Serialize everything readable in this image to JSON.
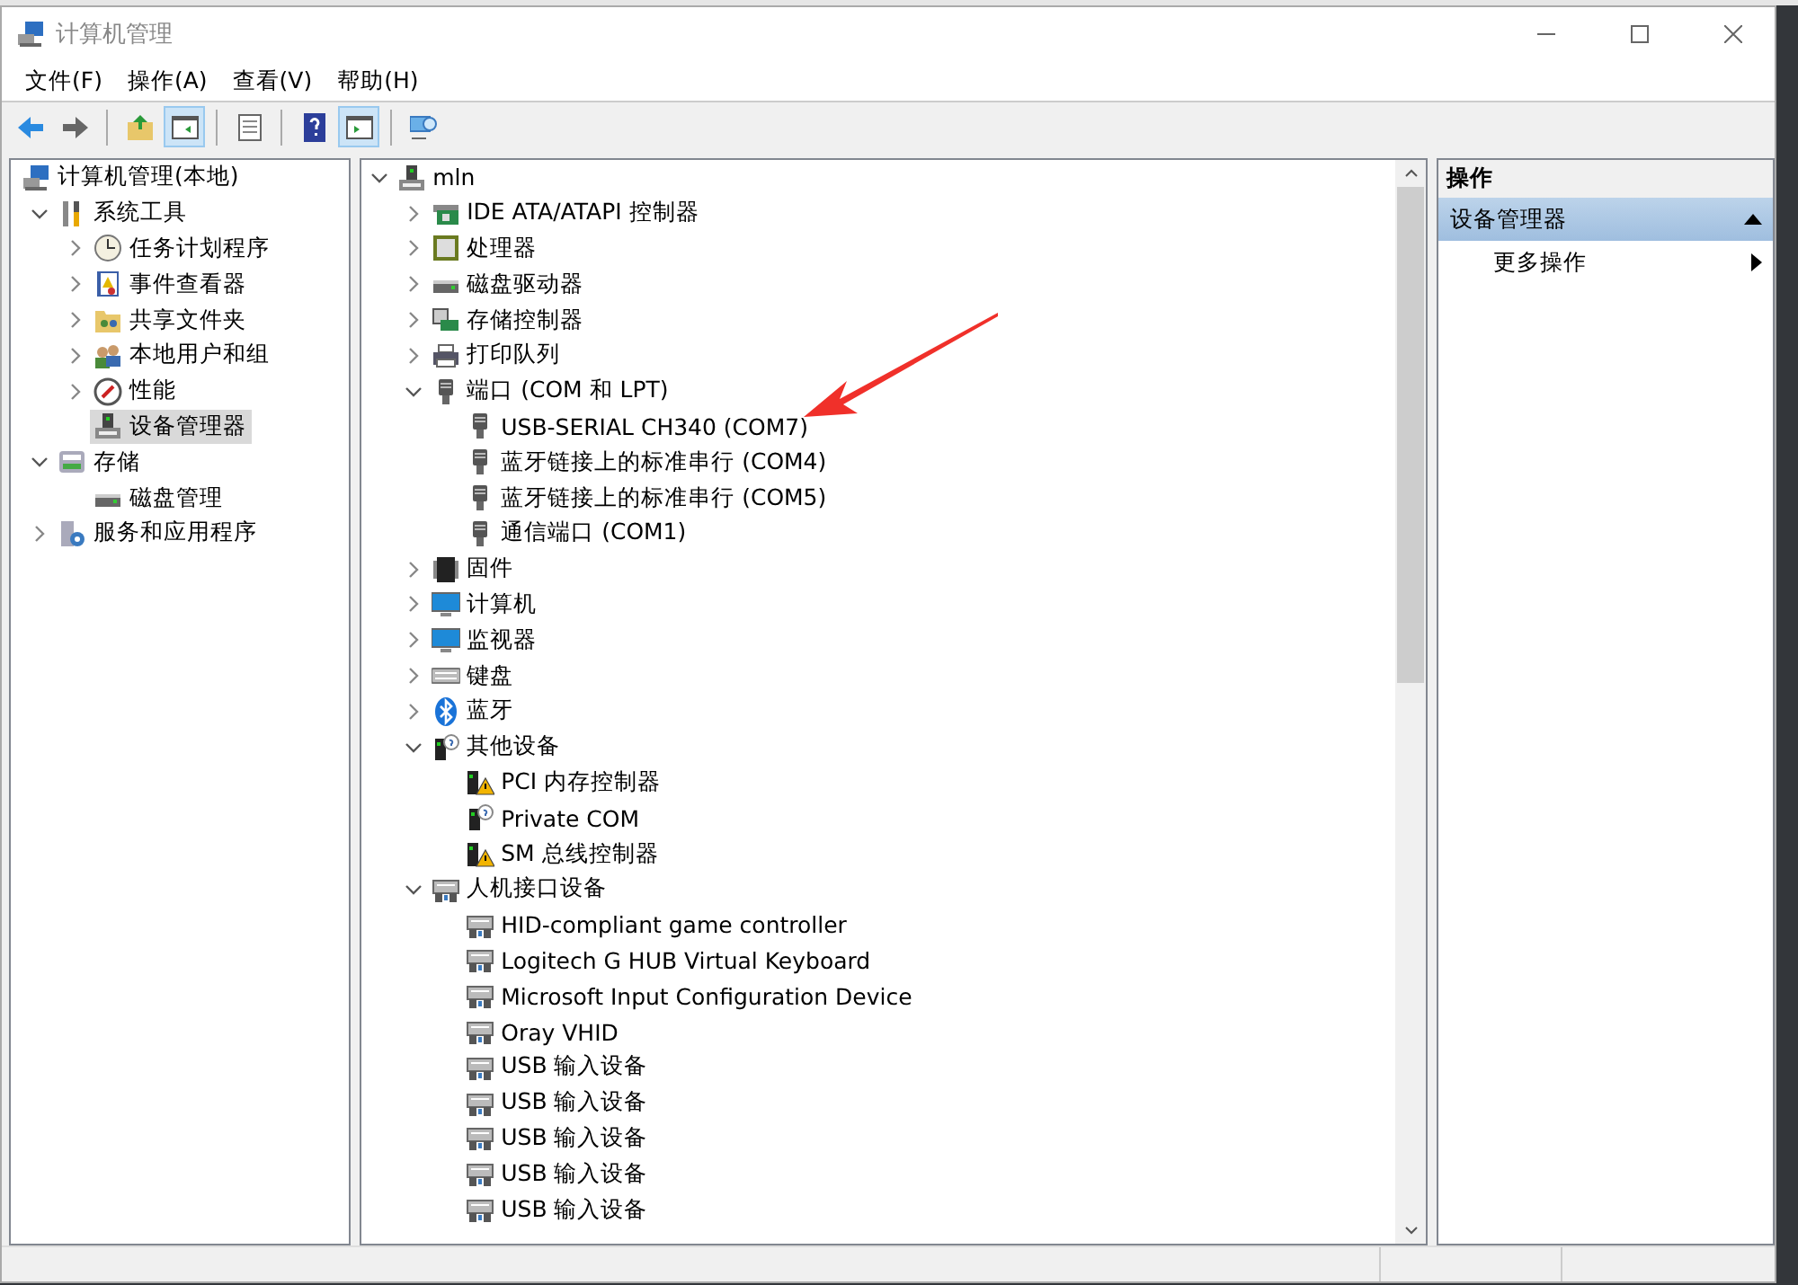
{
  "window": {
    "title": "计算机管理"
  },
  "menu": [
    {
      "label": "文件(F)"
    },
    {
      "label": "操作(A)"
    },
    {
      "label": "查看(V)"
    },
    {
      "label": "帮助(H)"
    }
  ],
  "toolbar": [
    {
      "kind": "back",
      "selected": false
    },
    {
      "kind": "forward",
      "selected": false
    },
    {
      "kind": "sep"
    },
    {
      "kind": "up",
      "selected": false
    },
    {
      "kind": "tree-pane",
      "selected": true
    },
    {
      "kind": "sep"
    },
    {
      "kind": "properties",
      "selected": false
    },
    {
      "kind": "sep"
    },
    {
      "kind": "help",
      "selected": false
    },
    {
      "kind": "action-pane",
      "selected": true
    },
    {
      "kind": "sep"
    },
    {
      "kind": "scan",
      "selected": false
    }
  ],
  "console_tree": [
    {
      "label": "计算机管理(本地)",
      "kind": "computer",
      "selected": false,
      "children": [
        {
          "label": "系统工具",
          "kind": "tools",
          "expanded": true,
          "selected": false,
          "children": [
            {
              "label": "任务计划程序",
              "kind": "clock",
              "expanded": false,
              "selected": false
            },
            {
              "label": "事件查看器",
              "kind": "event",
              "expanded": false,
              "selected": false
            },
            {
              "label": "共享文件夹",
              "kind": "share",
              "expanded": false,
              "selected": false
            },
            {
              "label": "本地用户和组",
              "kind": "users",
              "expanded": false,
              "selected": false
            },
            {
              "label": "性能",
              "kind": "perf",
              "expanded": false,
              "selected": false
            },
            {
              "label": "设备管理器",
              "kind": "devmgr",
              "selected": true
            }
          ]
        },
        {
          "label": "存储",
          "kind": "storage",
          "expanded": true,
          "selected": false,
          "children": [
            {
              "label": "磁盘管理",
              "kind": "drive",
              "selected": false
            }
          ]
        },
        {
          "label": "服务和应用程序",
          "kind": "services",
          "expanded": false,
          "selected": false
        }
      ]
    }
  ],
  "device_tree": [
    {
      "label": "mln",
      "kind": "devmgr",
      "expanded": true,
      "children": [
        {
          "label": "IDE ATA/ATAPI 控制器",
          "kind": "ide",
          "expanded": false
        },
        {
          "label": "处理器",
          "kind": "cpu",
          "expanded": false
        },
        {
          "label": "磁盘驱动器",
          "kind": "drive",
          "expanded": false
        },
        {
          "label": "存储控制器",
          "kind": "storagectl",
          "expanded": false
        },
        {
          "label": "打印队列",
          "kind": "printer",
          "expanded": false
        },
        {
          "label": "端口 (COM 和 LPT)",
          "kind": "port",
          "expanded": true,
          "children": [
            {
              "label": "USB-SERIAL CH340 (COM7)",
              "kind": "port"
            },
            {
              "label": "蓝牙链接上的标准串行 (COM4)",
              "kind": "port"
            },
            {
              "label": "蓝牙链接上的标准串行 (COM5)",
              "kind": "port"
            },
            {
              "label": "通信端口 (COM1)",
              "kind": "port"
            }
          ]
        },
        {
          "label": "固件",
          "kind": "chip",
          "expanded": false
        },
        {
          "label": "计算机",
          "kind": "monitor",
          "expanded": false
        },
        {
          "label": "监视器",
          "kind": "monitor",
          "expanded": false
        },
        {
          "label": "键盘",
          "kind": "keyboard",
          "expanded": false
        },
        {
          "label": "蓝牙",
          "kind": "bluetooth",
          "expanded": false
        },
        {
          "label": "其他设备",
          "kind": "unknown",
          "expanded": true,
          "children": [
            {
              "label": "PCI 内存控制器",
              "kind": "warn"
            },
            {
              "label": "Private COM",
              "kind": "unknown"
            },
            {
              "label": "SM 总线控制器",
              "kind": "warn"
            }
          ]
        },
        {
          "label": "人机接口设备",
          "kind": "hid",
          "expanded": true,
          "children": [
            {
              "label": "HID-compliant game controller",
              "kind": "hid"
            },
            {
              "label": "Logitech G HUB Virtual Keyboard",
              "kind": "hid"
            },
            {
              "label": "Microsoft Input Configuration Device",
              "kind": "hid"
            },
            {
              "label": "Oray VHID",
              "kind": "hid"
            },
            {
              "label": "USB 输入设备",
              "kind": "hid"
            },
            {
              "label": "USB 输入设备",
              "kind": "hid"
            },
            {
              "label": "USB 输入设备",
              "kind": "hid"
            },
            {
              "label": "USB 输入设备",
              "kind": "hid"
            },
            {
              "label": "USB 输入设备",
              "kind": "hid"
            }
          ]
        }
      ]
    }
  ],
  "actions": {
    "header": "操作",
    "sections": [
      {
        "title": "设备管理器",
        "expanded": true,
        "items": [
          {
            "label": "更多操作"
          }
        ]
      }
    ]
  }
}
